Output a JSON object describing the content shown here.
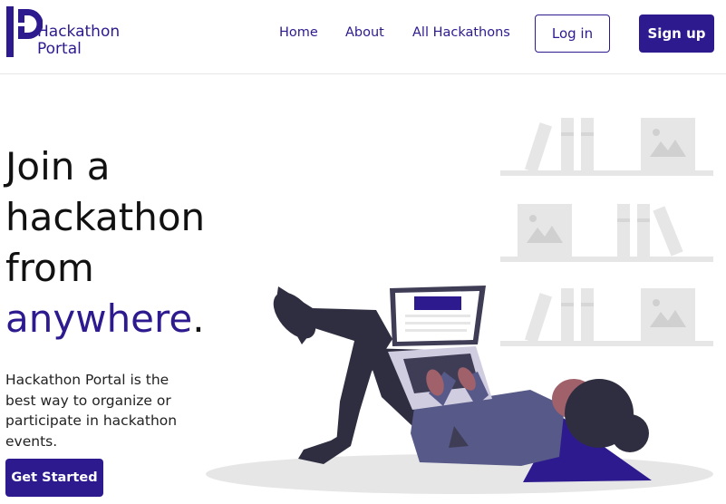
{
  "brand": {
    "name_line1": "Hackathon",
    "name_line2": "Portal",
    "primary_color": "#2e1a8f"
  },
  "nav": {
    "items": [
      {
        "label": "Home"
      },
      {
        "label": "About"
      },
      {
        "label": "All Hackathons"
      }
    ],
    "login_label": "Log in",
    "signup_label": "Sign up"
  },
  "hero": {
    "title_lines": [
      "Join a",
      "hackathon",
      "from"
    ],
    "title_accent": "anywhere",
    "title_punct": ".",
    "description": "Hackathon Portal is the best way to organize or participate in hackathon events.",
    "cta_label": "Get Started"
  },
  "illustration": {
    "icon": "person-reading-laptop-illustration"
  }
}
